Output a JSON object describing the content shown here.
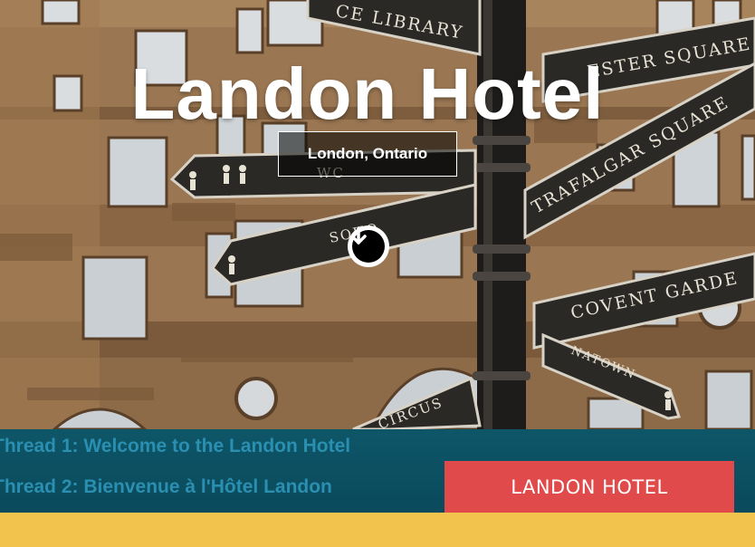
{
  "hero": {
    "title": "Landon Hotel",
    "subtitle": "London, Ontario",
    "scroll_icon": "arrow-down-circle-icon",
    "signs": {
      "sign_1": "CE LIBRARY",
      "sign_2": "ESTER SQUARE",
      "sign_3": "TRAFALGAR SQUARE",
      "sign_4": "WC",
      "sign_5": "SOHO",
      "sign_6": "COVENT GARDE",
      "sign_7": "NATOWN",
      "sign_8": "CIRCUS"
    }
  },
  "threads": {
    "line_1": "Thread 1: Welcome to the Landon Hotel",
    "line_2": "Thread 2: Bienvenue à l'Hôtel Landon"
  },
  "cta": {
    "label": "LANDON HOTEL"
  },
  "colors": {
    "thread_bar": "#0a4a5c",
    "thread_text": "#2a8fb0",
    "button": "#e04a4a",
    "band": "#f2c44e"
  }
}
